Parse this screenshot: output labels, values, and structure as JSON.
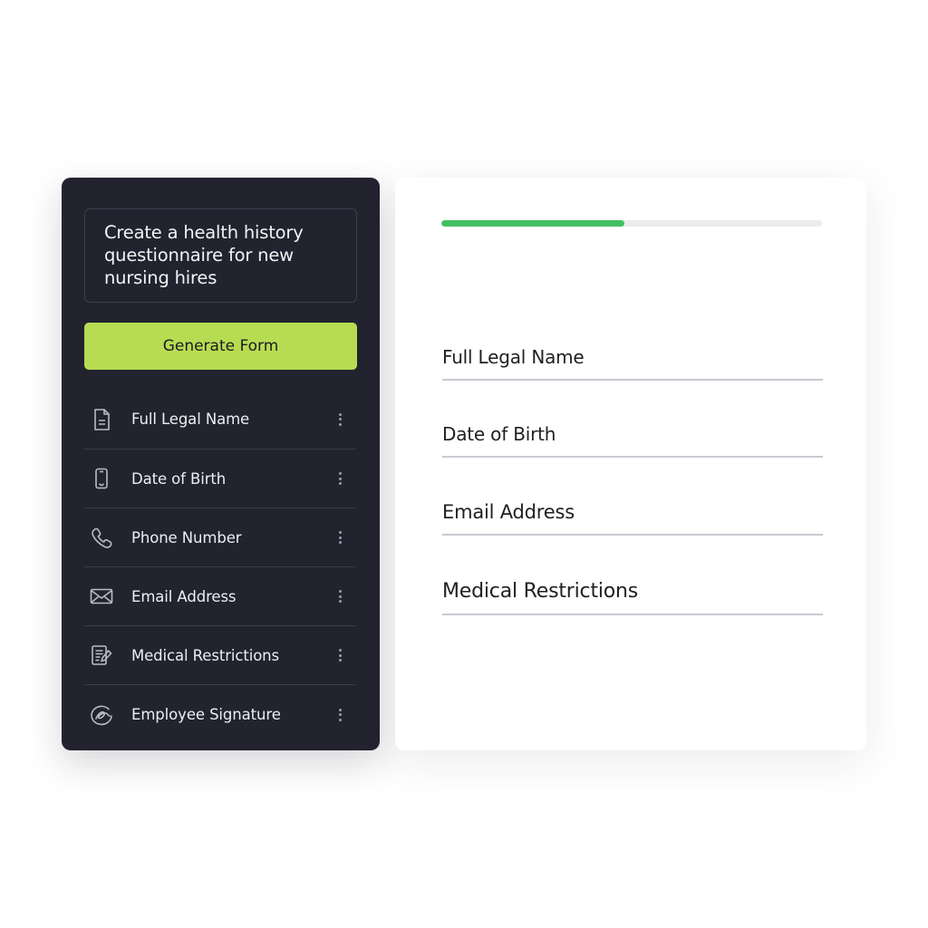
{
  "builder": {
    "prompt_text": "Create a health history questionnaire for new nursing hires",
    "generate_label": "Generate Form",
    "fields": [
      {
        "label": "Full Legal Name",
        "icon": "document-icon"
      },
      {
        "label": "Date of Birth",
        "icon": "mobile-icon"
      },
      {
        "label": "Phone Number",
        "icon": "phone-icon"
      },
      {
        "label": "Email Address",
        "icon": "envelope-icon"
      },
      {
        "label": "Medical Restrictions",
        "icon": "clipboard-edit-icon"
      },
      {
        "label": "Employee Signature",
        "icon": "signature-icon"
      }
    ]
  },
  "preview": {
    "progress_fraction": 0.48,
    "fields": [
      {
        "label": "Full Legal Name"
      },
      {
        "label": "Date of Birth"
      },
      {
        "label": "Email Address"
      },
      {
        "label": "Medical Restrictions"
      }
    ]
  },
  "colors": {
    "panel_bg": "#22232e",
    "accent_button": "#b7dc52",
    "progress": "#43c061"
  }
}
